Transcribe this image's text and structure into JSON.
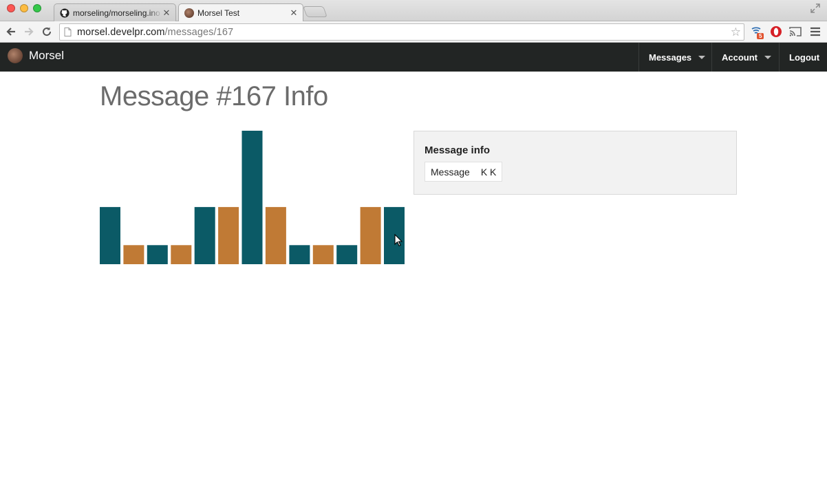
{
  "browser": {
    "tabs": [
      {
        "title": "morseling/morseling.ino a",
        "active": false,
        "favicon": "github-icon"
      },
      {
        "title": "Morsel Test",
        "active": true,
        "favicon": "morsel-logo-icon"
      }
    ],
    "url": {
      "host": "morsel.develpr.com",
      "path": "/messages/167"
    },
    "extension_badge": "5"
  },
  "navbar": {
    "brand": "Morsel",
    "items": [
      {
        "label": "Messages",
        "dropdown": true
      },
      {
        "label": "Account",
        "dropdown": true
      },
      {
        "label": "Logout",
        "dropdown": false
      }
    ]
  },
  "page": {
    "title": "Message #167 Info"
  },
  "info_panel": {
    "heading": "Message info",
    "rows": [
      {
        "label": "Message",
        "value": "K K"
      }
    ]
  },
  "colors": {
    "navbar_bg": "#222524",
    "dot_color": "#0b5a66",
    "dash_color": "#c07a35"
  },
  "chart_data": {
    "type": "bar",
    "description_units": "relative bar heights (short=1, medium=3, tall=7)",
    "values": [
      3,
      1,
      1,
      1,
      3,
      3,
      7,
      3,
      1,
      1,
      1,
      3,
      3
    ],
    "colors": [
      "teal",
      "orange",
      "teal",
      "orange",
      "teal",
      "orange",
      "teal",
      "orange",
      "teal",
      "orange",
      "teal",
      "orange",
      "teal"
    ],
    "ylim": [
      0,
      7
    ]
  }
}
